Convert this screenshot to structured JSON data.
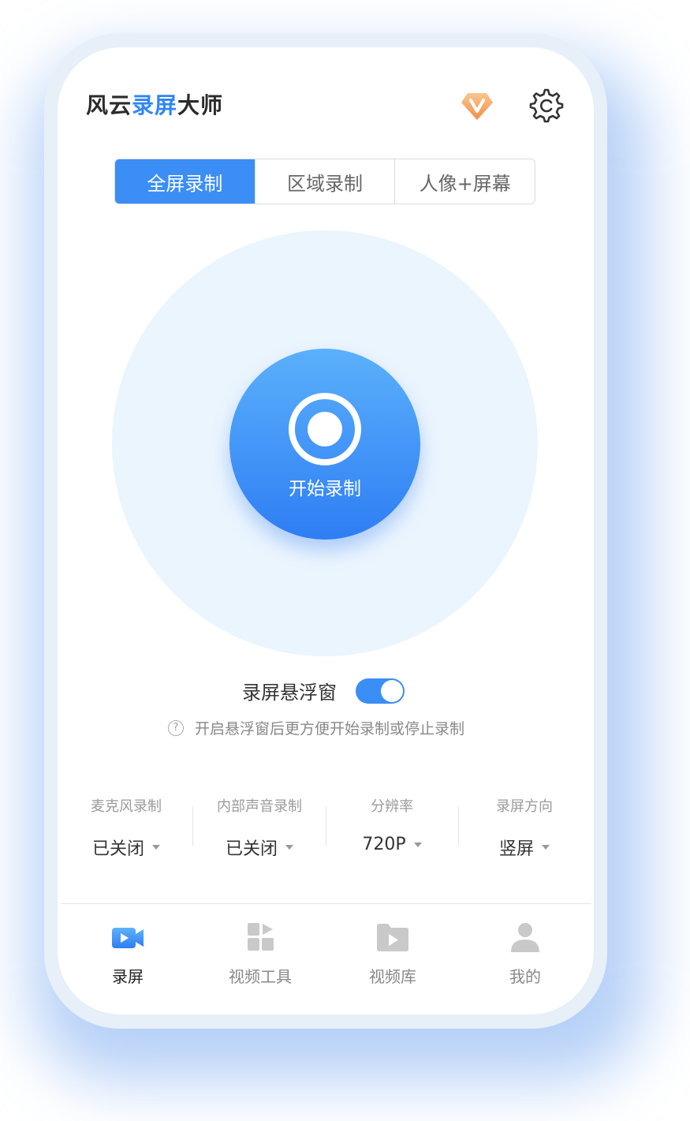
{
  "app": {
    "title_part1": "风云",
    "title_accent": "录屏",
    "title_part2": "大师"
  },
  "tabs": [
    {
      "label": "全屏录制",
      "active": true
    },
    {
      "label": "区域录制",
      "active": false
    },
    {
      "label": "人像+屏幕",
      "active": false
    }
  ],
  "record_button": {
    "label": "开始录制"
  },
  "floating_window": {
    "label": "录屏悬浮窗",
    "enabled": true,
    "hint": "开启悬浮窗后更方便开始录制或停止录制"
  },
  "settings": [
    {
      "label": "麦克风录制",
      "value": "已关闭"
    },
    {
      "label": "内部声音录制",
      "value": "已关闭"
    },
    {
      "label": "分辨率",
      "value": "720P"
    },
    {
      "label": "录屏方向",
      "value": "竖屏"
    }
  ],
  "nav": [
    {
      "label": "录屏",
      "icon": "video-camera-icon",
      "active": true
    },
    {
      "label": "视频工具",
      "icon": "tools-grid-icon",
      "active": false
    },
    {
      "label": "视频库",
      "icon": "video-folder-icon",
      "active": false
    },
    {
      "label": "我的",
      "icon": "user-profile-icon",
      "active": false
    }
  ],
  "colors": {
    "accent": "#3a8ef6",
    "vip_gold": "#f5a25d"
  }
}
